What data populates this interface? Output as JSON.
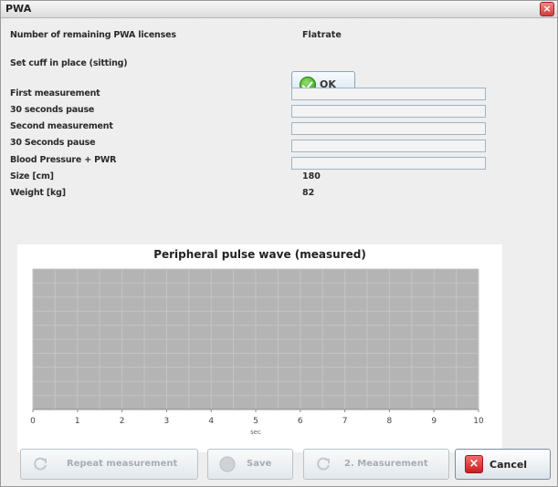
{
  "window": {
    "title": "PWA",
    "close_glyph": "×"
  },
  "fields": {
    "licenses_label": "Number of remaining PWA licenses",
    "licenses_value": "Flatrate",
    "cuff_label": "Set cuff in place (sitting)",
    "ok_label": "OK",
    "first_measurement": "First measurement",
    "pause_1": "30 seconds pause",
    "second_measurement": "Second measurement",
    "pause_2": "30 Seconds pause",
    "bp_pwa": "Blood Pressure + PWR",
    "size_label": "Size [cm]",
    "size_value": "180",
    "weight_label": "Weight [kg]",
    "weight_value": "82"
  },
  "progress": {
    "first_measurement": 0,
    "pause_1": 0,
    "second_measurement": 0,
    "pause_2": 0,
    "bp_pwa": 0
  },
  "chart_data": {
    "type": "line",
    "title": "Peripheral pulse wave (measured)",
    "xlabel": "sec",
    "ylabel": "",
    "xlim": [
      0,
      10
    ],
    "x_ticks": [
      "0",
      "1",
      "2",
      "3",
      "4",
      "5",
      "6",
      "7",
      "8",
      "9",
      "10"
    ],
    "series": [],
    "plot_background": "#b4b4b4",
    "grid": true
  },
  "buttons": {
    "repeat": "Repeat measurement",
    "save": "Save",
    "second_measurement": "2. Measurement",
    "cancel": "Cancel"
  },
  "colors": {
    "plot_fill": "#b4b4b4",
    "grid": "#c4c4c4",
    "cancel_red": "#c81e1e",
    "ok_green": "#2d9a12"
  }
}
